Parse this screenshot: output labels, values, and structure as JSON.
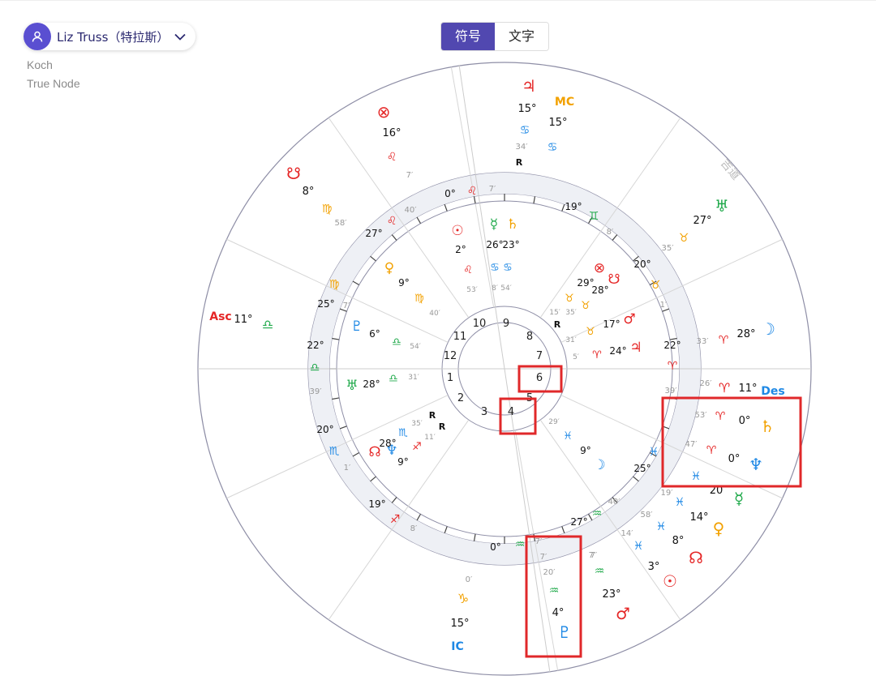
{
  "person": {
    "name": "Liz Truss（特拉斯）"
  },
  "house_system": "Koch",
  "node_type": "True Node",
  "view_toggle": {
    "symbol_label": "符号",
    "text_label": "文字"
  },
  "colors": {
    "accent": "#5148b0",
    "fire": "#e52626",
    "earth": "#f2a100",
    "air": "#1fa94a",
    "water": "#1e88e5",
    "highlight": "#e0282a"
  },
  "chart_data": {
    "type": "astrology-natal-wheel",
    "outer_watermark": "吉道",
    "house_numbers": [
      "1",
      "2",
      "3",
      "4",
      "5",
      "6",
      "7",
      "8",
      "9",
      "10",
      "11",
      "12"
    ],
    "highlighted_houses": [
      "4",
      "6"
    ],
    "angles": [
      {
        "label": "Asc",
        "deg": "11°",
        "sign": "♎"
      },
      {
        "label": "Des",
        "deg": "11°",
        "sign": "♈"
      },
      {
        "label": "MC",
        "deg": "15°",
        "sign": "♋"
      },
      {
        "label": "IC",
        "deg": "15°",
        "sign": "♑"
      }
    ],
    "transit_points": [
      {
        "glyph": "♃",
        "deg": "15°",
        "sign": "♋",
        "min": "34′",
        "retro": "R"
      },
      {
        "glyph": "⊗",
        "deg": "16°",
        "sign": "♌",
        "min": "7′"
      },
      {
        "glyph": "☋",
        "deg": "8°",
        "sign": "♍",
        "min": "58′"
      },
      {
        "glyph": "♅",
        "deg": "27°",
        "sign": "♉",
        "min": "35′"
      },
      {
        "glyph": "☽",
        "deg": "28°",
        "sign": "♈",
        "min": "33′"
      },
      {
        "glyph": "♄",
        "deg": "0°",
        "sign": "♈",
        "min": "53′"
      },
      {
        "glyph": "♆",
        "deg": "0°",
        "sign": "♈",
        "min": "47′"
      },
      {
        "glyph": "☿",
        "deg": "20",
        "sign": "♓",
        "min": "19′"
      },
      {
        "glyph": "♀",
        "deg": "14°",
        "sign": "♓",
        "min": "58′"
      },
      {
        "glyph": "☊",
        "deg": "8°",
        "sign": "♓",
        "min": "14′"
      },
      {
        "glyph": "☉",
        "deg": "3°",
        "sign": "♓",
        "min": ""
      },
      {
        "glyph": "♂",
        "deg": "23°",
        "sign": "♒",
        "min": "7′"
      },
      {
        "glyph": "♇",
        "deg": "4°",
        "sign": "♒",
        "min": "20′"
      }
    ],
    "natal_points": [
      {
        "glyph": "☉",
        "deg": "2°",
        "sign": "♌",
        "min": "53′"
      },
      {
        "glyph": "☿",
        "deg": "26°",
        "sign": "♋",
        "min": "8′"
      },
      {
        "glyph": "♄",
        "deg": "23°",
        "sign": "♋",
        "min": "54′"
      },
      {
        "glyph": "♀",
        "deg": "9°",
        "sign": "♍",
        "min": "40′"
      },
      {
        "glyph": "♇",
        "deg": "6°",
        "sign": "♎",
        "min": "54′"
      },
      {
        "glyph": "♅",
        "deg": "28°",
        "sign": "♎",
        "min": "31′"
      },
      {
        "glyph": "⊗",
        "deg": "29°",
        "sign": "♉",
        "min": "15′"
      },
      {
        "glyph": "☋",
        "deg": "28°",
        "sign": "♉",
        "min": "35′"
      },
      {
        "glyph": "♂",
        "deg": "17°",
        "sign": "♉",
        "min": "31′"
      },
      {
        "glyph": "♃",
        "deg": "24°",
        "sign": "♈",
        "min": "5′"
      },
      {
        "glyph": "♆",
        "deg": "9°",
        "sign": "♐",
        "min": "11′"
      },
      {
        "glyph": "☊",
        "deg": "28°",
        "sign": "♏",
        "min": "35′"
      },
      {
        "glyph": "☽",
        "deg": "9°",
        "sign": "♓",
        "min": "29′"
      }
    ],
    "cusps": [
      "0°",
      "7′",
      "19°",
      "8′",
      "20°",
      "1′",
      "22°",
      "39′",
      "26′",
      "25°",
      "40′",
      "27°",
      "7′",
      "0°",
      "7′",
      "19°",
      "8′",
      "20°",
      "1′",
      "22°",
      "39′",
      "25°",
      "7′",
      "27°",
      "40′"
    ]
  }
}
